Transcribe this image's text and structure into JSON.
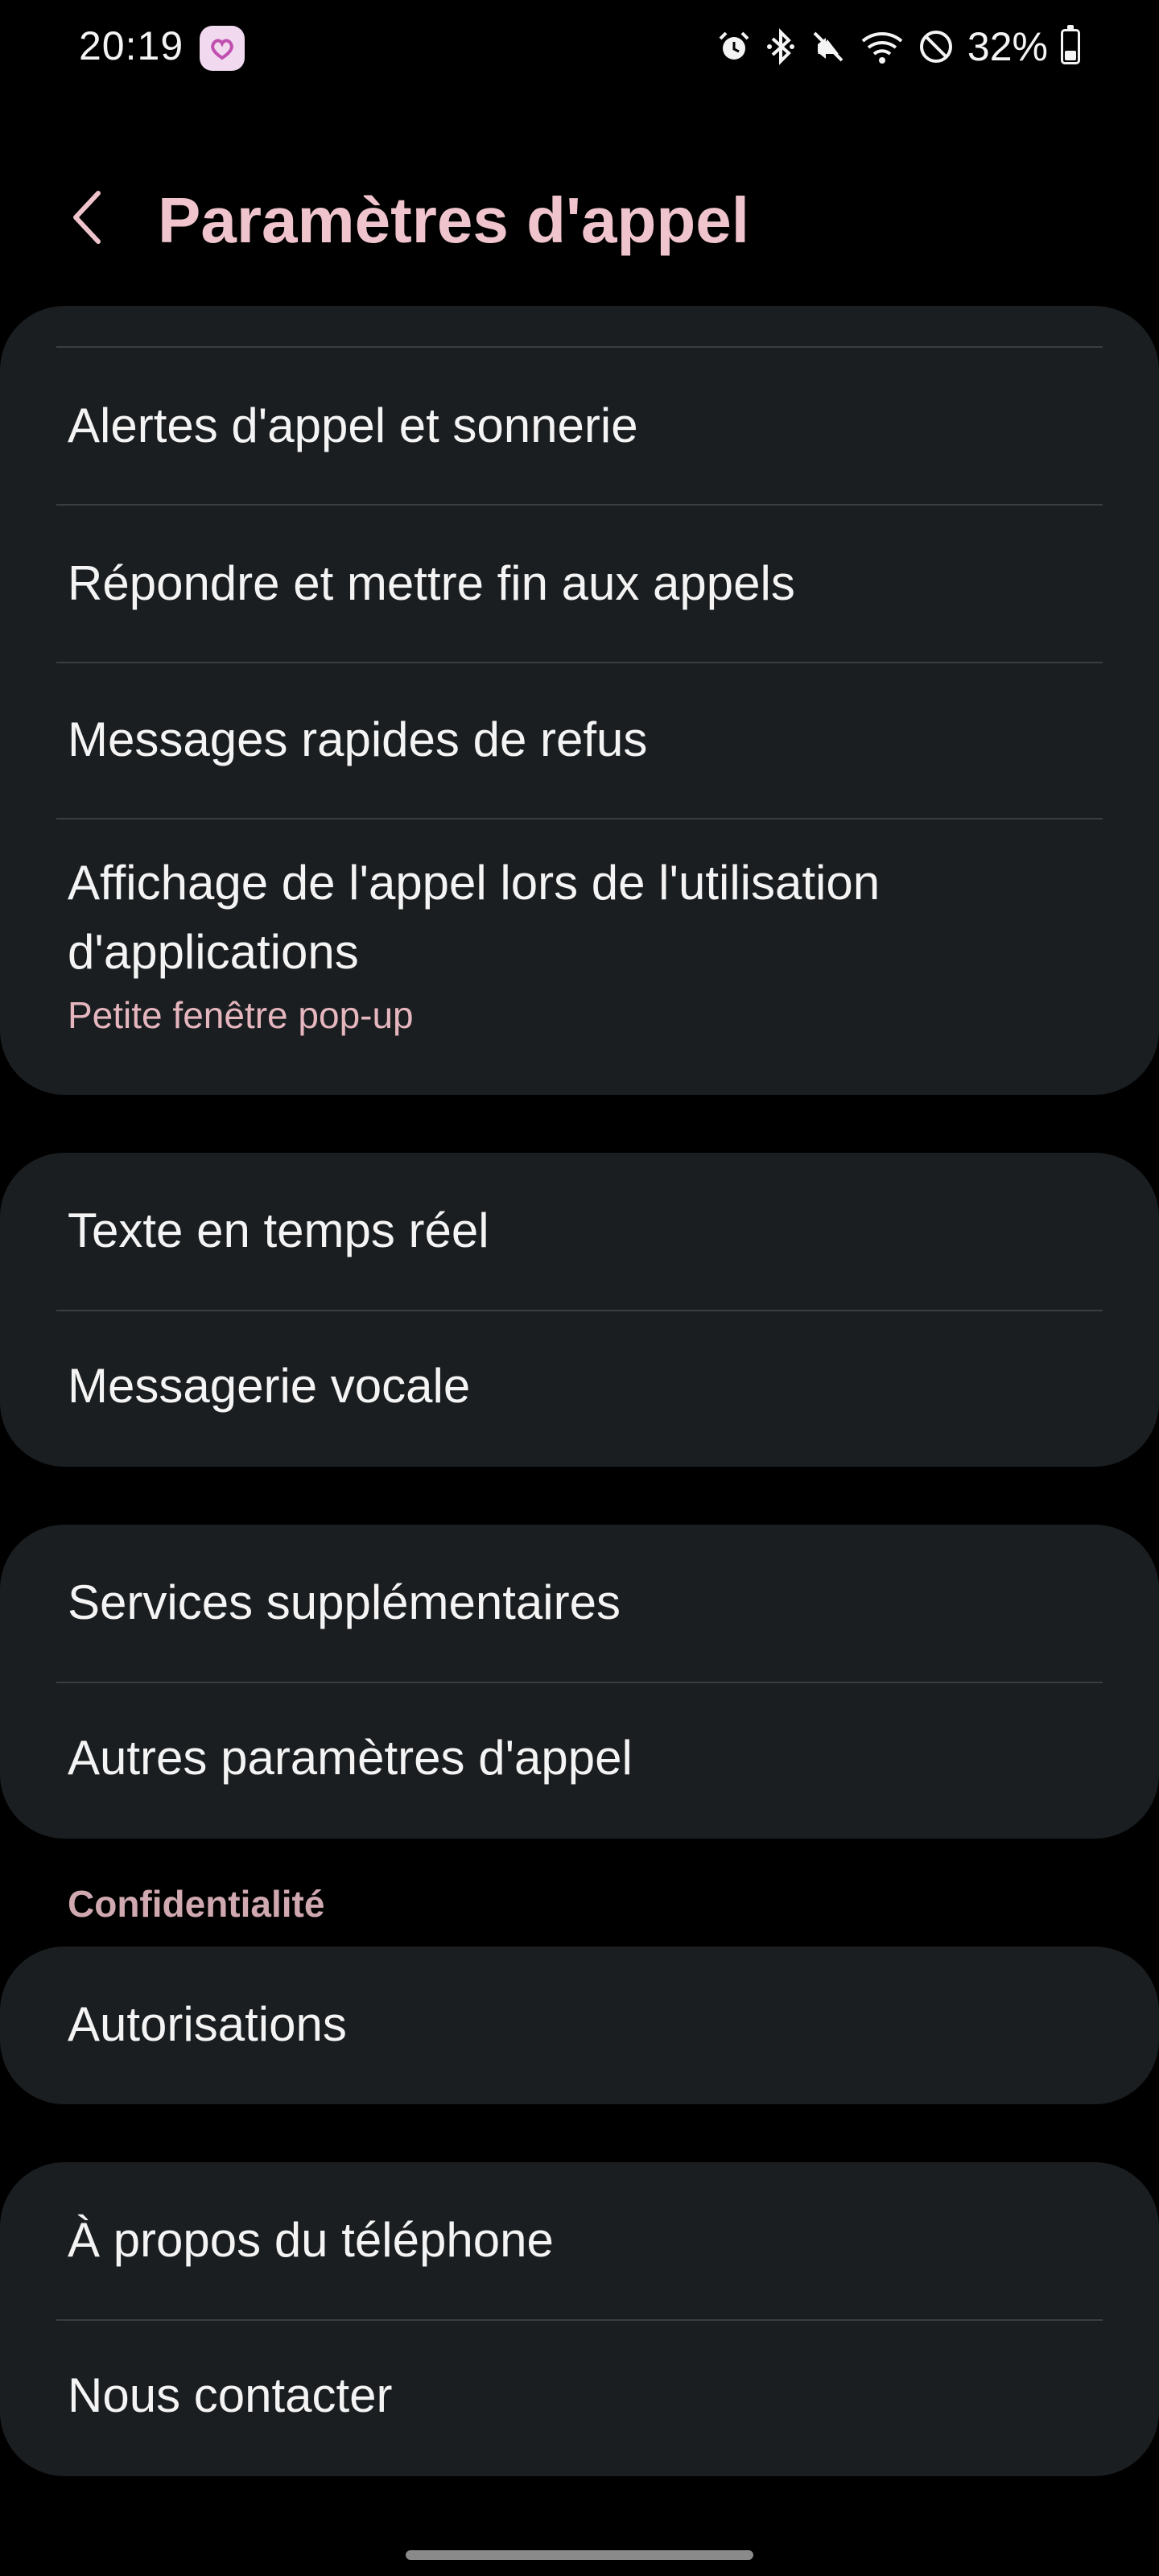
{
  "status_bar": {
    "time": "20:19",
    "battery": "32%",
    "battery_level": 0.32,
    "icons": [
      "alarm-icon",
      "bluetooth-icon",
      "mute-icon",
      "wifi-icon",
      "do-not-disturb-icon",
      "battery-icon"
    ]
  },
  "header": {
    "title": "Paramètres d'appel",
    "back_icon": "chevron-left-icon"
  },
  "groups": {
    "call": {
      "alerts": "Alertes d'appel et sonnerie",
      "answer_end": "Répondre et mettre fin aux appels",
      "quick_decline": "Messages rapides de refus",
      "display_line1": "Affichage de l'appel lors de l'utilisation",
      "display_line2": "d'applications",
      "display_value": "Petite fenêtre pop-up"
    },
    "rtt": {
      "rtt": "Texte en temps réel",
      "voicemail": "Messagerie vocale"
    },
    "services": {
      "supplementary": "Services supplémentaires",
      "other": "Autres paramètres d'appel"
    },
    "privacy": {
      "section": "Confidentialité",
      "permissions": "Autorisations"
    },
    "about": {
      "about_phone": "À propos du téléphone",
      "contact": "Nous contacter"
    }
  },
  "colors": {
    "background": "#000000",
    "card": "#1b1e20",
    "accent": "#efc4cc",
    "text": "#f4f4f4",
    "divider": "#3a3e41"
  }
}
